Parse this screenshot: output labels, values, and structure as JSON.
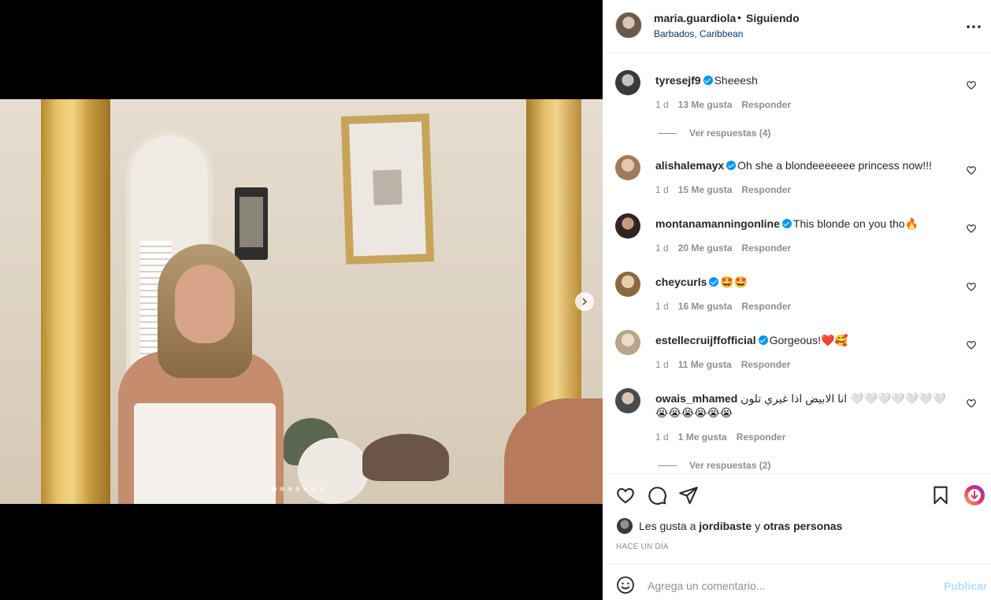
{
  "post": {
    "username": "maria.guardiola",
    "separator": "•",
    "follow_status": "Siguiendo",
    "location": "Barbados, Caribbean"
  },
  "carousel": {
    "slides": 7,
    "active_index": 0
  },
  "comments": [
    {
      "user": "tyresejf9",
      "verified": true,
      "text": "Sheeesh",
      "age": "1 d",
      "likes": "13 Me gusta",
      "reply": "Responder",
      "view_replies": "Ver respuestas (4)"
    },
    {
      "user": "alishalemayx",
      "verified": true,
      "text": "Oh she a blondeeeeeee princess now!!!",
      "age": "1 d",
      "likes": "15 Me gusta",
      "reply": "Responder"
    },
    {
      "user": "montanamanningonline",
      "verified": true,
      "text": "This blonde on you tho🔥",
      "age": "1 d",
      "likes": "20 Me gusta",
      "reply": "Responder"
    },
    {
      "user": "cheycurls",
      "verified": true,
      "text": "🤩🤩",
      "age": "1 d",
      "likes": "16 Me gusta",
      "reply": "Responder"
    },
    {
      "user": "estellecruijffofficial",
      "verified": true,
      "text": "Gorgeous!❤️🥰",
      "age": "1 d",
      "likes": "11 Me gusta",
      "reply": "Responder"
    },
    {
      "user": "owais_mhamed",
      "verified": false,
      "text": "انا الابيض اذا غيري تلون 🤍🤍🤍🤍🤍🤍🤍 😭😭😭😭😭😭",
      "age": "1 d",
      "likes": "1 Me gusta",
      "reply": "Responder",
      "view_replies": "Ver respuestas (2)"
    }
  ],
  "likes_line": {
    "prefix": "Les gusta a",
    "user": "jordibaste",
    "suffix_connector": "y",
    "suffix": "otras personas"
  },
  "time_ago": "HACE UN DÍA",
  "composer": {
    "placeholder": "Agrega un comentario...",
    "publish": "Publicar"
  },
  "colors": {
    "link": "#00376b",
    "verified": "#0095f6",
    "publish_disabled": "#b2dffc",
    "meta": "#8e8e8e"
  },
  "icons": [
    "heart-icon",
    "comment-icon",
    "share-icon",
    "bookmark-icon",
    "download-icon",
    "more-icon",
    "emoji-icon",
    "chevron-right-icon"
  ]
}
